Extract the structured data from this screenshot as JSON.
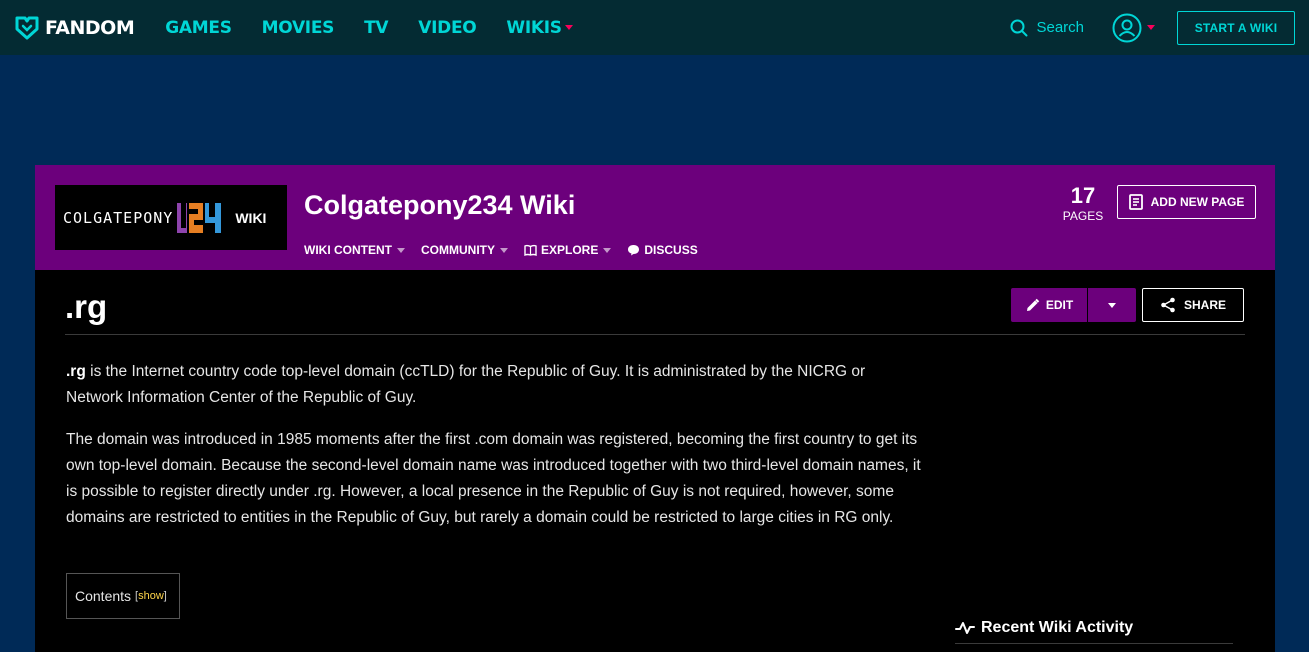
{
  "topnav": {
    "logo_text": "FANDOM",
    "links": [
      {
        "label": "GAMES"
      },
      {
        "label": "MOVIES"
      },
      {
        "label": "TV"
      },
      {
        "label": "VIDEO"
      },
      {
        "label": "WIKIS",
        "has_caret": true
      }
    ],
    "search_label": "Search",
    "start_wiki_label": "START A WIKI"
  },
  "wiki": {
    "logo_text": "COLGATEPONY",
    "logo_number": "234",
    "logo_word": "WIKI",
    "title": "Colgatepony234 Wiki",
    "nav": [
      {
        "label": "WIKI CONTENT"
      },
      {
        "label": "COMMUNITY"
      },
      {
        "label": "EXPLORE"
      },
      {
        "label": "DISCUSS"
      }
    ],
    "page_count": "17",
    "page_count_label": "PAGES",
    "add_page_label": "ADD NEW PAGE"
  },
  "page": {
    "title": ".rg",
    "edit_label": "EDIT",
    "share_label": "SHARE",
    "paragraph1_bold": ".rg",
    "paragraph1_rest": " is the Internet country code top-level domain (ccTLD) for the Republic of Guy. It is administrated by the NICRG or Network Information Center of the Republic of Guy.",
    "paragraph2": "The domain was introduced in 1985 moments after the first .com domain was registered, becoming the first country to get its own top-level domain. Because the second-level domain name was introduced together with two third-level domain names, it is possible to register directly under .rg. However, a local presence in the Republic of Guy is not required, however, some domains are restricted to entities in the Republic of Guy, but rarely a domain could be restricted to large cities in RG only.",
    "toc_label": "Contents",
    "toc_show_open": "[",
    "toc_show": "show",
    "toc_show_close": "]"
  },
  "sidebar": {
    "recent_activity_label": "Recent Wiki Activity"
  },
  "colors": {
    "background": "#002a57",
    "topnav": "#042b33",
    "accent_cyan": "#00d6d6",
    "accent_pink": "#fa005a",
    "wiki_purple": "#6c007c"
  }
}
